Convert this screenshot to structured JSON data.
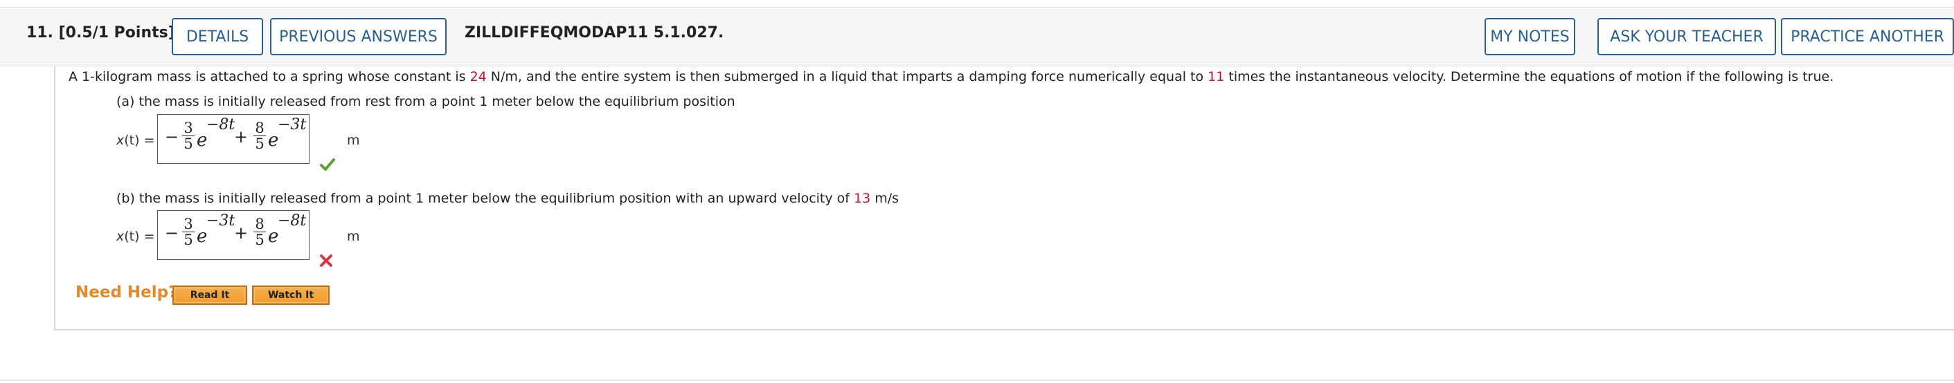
{
  "header": {
    "question_number": "11.  [0.5/1 Points]",
    "buttons": {
      "details": "DETAILS",
      "previous_answers": "PREVIOUS ANSWERS",
      "my_notes": "MY NOTES",
      "ask_teacher": "ASK YOUR TEACHER",
      "practice_another": "PRACTICE ANOTHER"
    },
    "problem_code": "ZILLDIFFEQMODAP11 5.1.027."
  },
  "problem": {
    "intro_1": "A 1-kilogram mass is attached to a spring whose constant is ",
    "spring_constant": "24",
    "intro_2": " N/m, and the entire system is then submerged in a liquid that imparts a damping force numerically equal to ",
    "damping": "11",
    "intro_3": " times the instantaneous velocity. Determine the equations of motion if the following is true."
  },
  "part_a": {
    "prompt": "(a) the mass is initially released from rest from a point 1 meter below the equilibrium position",
    "label_var": "x",
    "label_rest": "(t) =",
    "answer": {
      "sign1": "−",
      "frac1_num": "3",
      "frac1_den": "5",
      "exp1": "−8t",
      "op": "+",
      "frac2_num": "8",
      "frac2_den": "5",
      "exp2": "−3t",
      "e": "e"
    },
    "unit": "m",
    "status": "correct",
    "status_color": "#5aa02c"
  },
  "part_b": {
    "prompt_1": "(b) the mass is initially released from a point 1 meter below the equilibrium position with an upward velocity of ",
    "velocity": "13",
    "prompt_2": " m/s",
    "label_var": "x",
    "label_rest": "(t) =",
    "answer": {
      "sign1": "−",
      "frac1_num": "3",
      "frac1_den": "5",
      "exp1": "−3t",
      "op": "+",
      "frac2_num": "8",
      "frac2_den": "5",
      "exp2": "−8t",
      "e": "e"
    },
    "unit": "m",
    "status": "incorrect",
    "status_color": "#d9363e"
  },
  "help": {
    "label": "Need Help?",
    "read_it": "Read It",
    "watch_it": "Watch It"
  },
  "colors": {
    "button_border": "#2b5f8f",
    "highlight_red": "#c8102e",
    "help_orange": "#e08a2c"
  }
}
